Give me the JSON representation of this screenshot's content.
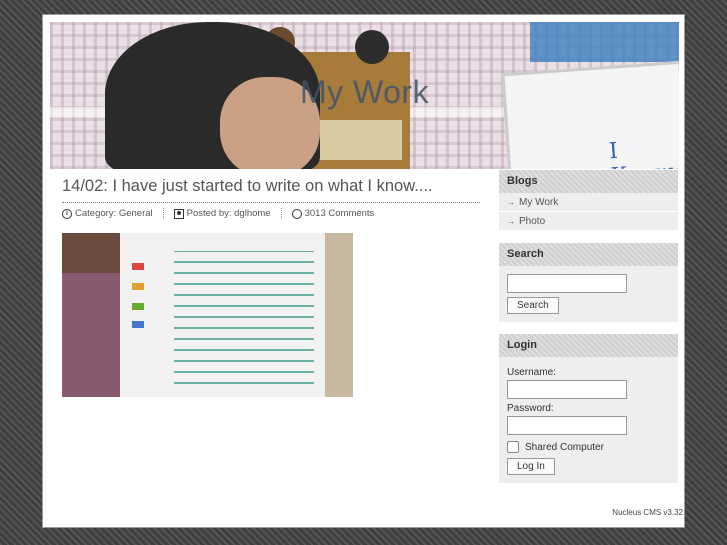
{
  "site": {
    "title": "My Work"
  },
  "header_image": {
    "board_text": "I Know"
  },
  "post": {
    "title": "14/02: I have just started to write on what I know....",
    "meta": {
      "category": "Category: General",
      "posted_by": "Posted by: dglhome",
      "comments": "3013 Comments"
    },
    "image_icon": "photo-of-whiteboard"
  },
  "sidebar": {
    "blogs": {
      "heading": "Blogs",
      "items": [
        "My Work",
        "Photo"
      ]
    },
    "search": {
      "heading": "Search",
      "input_value": "",
      "button_label": "Search"
    },
    "login": {
      "heading": "Login",
      "username_label": "Username:",
      "password_label": "Password:",
      "shared_label": "Shared Computer",
      "shared_checked": false,
      "button_label": "Log In"
    }
  },
  "footer": {
    "text": "Nucleus CMS v3.32"
  },
  "colors": {
    "background": "#4a4a4a",
    "page": "#ffffff",
    "sidebar_block": "#eeeeee",
    "title_text": "#40546b"
  }
}
